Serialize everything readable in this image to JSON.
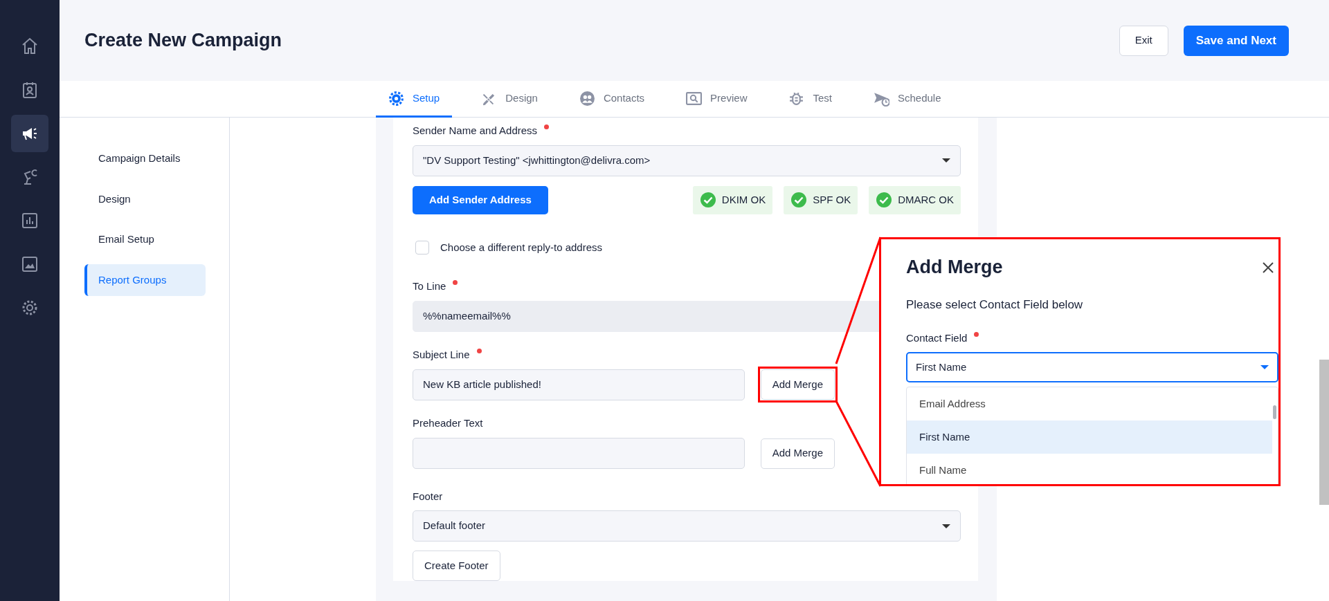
{
  "nav_rail": [
    {
      "kind": "home",
      "selected": false
    },
    {
      "kind": "contacts",
      "selected": false
    },
    {
      "kind": "campaigns",
      "selected": true
    },
    {
      "kind": "automation",
      "selected": false
    },
    {
      "kind": "reports",
      "selected": false
    },
    {
      "kind": "media",
      "selected": false
    },
    {
      "kind": "settings",
      "selected": false
    }
  ],
  "header": {
    "title": "Create New Campaign",
    "buttons": [
      {
        "label": "Exit",
        "kind": "secondary"
      },
      {
        "label": "Save and Next",
        "kind": "primary"
      }
    ]
  },
  "tabs": [
    {
      "label": "Setup",
      "kind": "setup",
      "selected": true
    },
    {
      "label": "Design",
      "kind": "design",
      "selected": false
    },
    {
      "label": "Contacts",
      "kind": "contacts",
      "selected": false
    },
    {
      "label": "Preview",
      "kind": "preview",
      "selected": false
    },
    {
      "label": "Test",
      "kind": "test",
      "selected": false
    },
    {
      "label": "Schedule",
      "kind": "schedule",
      "selected": false
    }
  ],
  "sections": [
    {
      "label": "Campaign Details",
      "selected": false
    },
    {
      "label": "Design",
      "selected": false
    },
    {
      "label": "Email Setup",
      "selected": false
    },
    {
      "label": "Report Groups",
      "selected": true
    }
  ],
  "form": {
    "sender": {
      "label": "Sender Name and Address",
      "required": true,
      "value": "\"DV Support Testing\" <jwhittington@delivra.com>",
      "button": "Add Sender Address",
      "checks": [
        {
          "label": "DKIM OK"
        },
        {
          "label": "SPF OK"
        },
        {
          "label": "DMARC OK"
        }
      ]
    },
    "reply_to": {
      "label": "Choose a different reply-to address",
      "checked": false
    },
    "to_line": {
      "label": "To Line",
      "required": true,
      "value": "%%nameemail%%"
    },
    "subject": {
      "label": "Subject Line",
      "required": true,
      "value": "New KB article published!",
      "button": "Add Merge",
      "highlighted": true
    },
    "preheader": {
      "label": "Preheader Text",
      "required": false,
      "button": "Add Merge",
      "highlighted": false
    },
    "footer": {
      "label": "Footer",
      "value": "Default footer",
      "button": "Create Footer"
    }
  },
  "merge_dialog": {
    "title": "Add Merge",
    "prompt": "Please select Contact Field below",
    "field_label": "Contact Field",
    "required": true,
    "value": "First Name",
    "options": [
      {
        "label": "Email Address",
        "selected": false
      },
      {
        "label": "First Name",
        "selected": true
      },
      {
        "label": "Full Name",
        "selected": false
      }
    ]
  }
}
